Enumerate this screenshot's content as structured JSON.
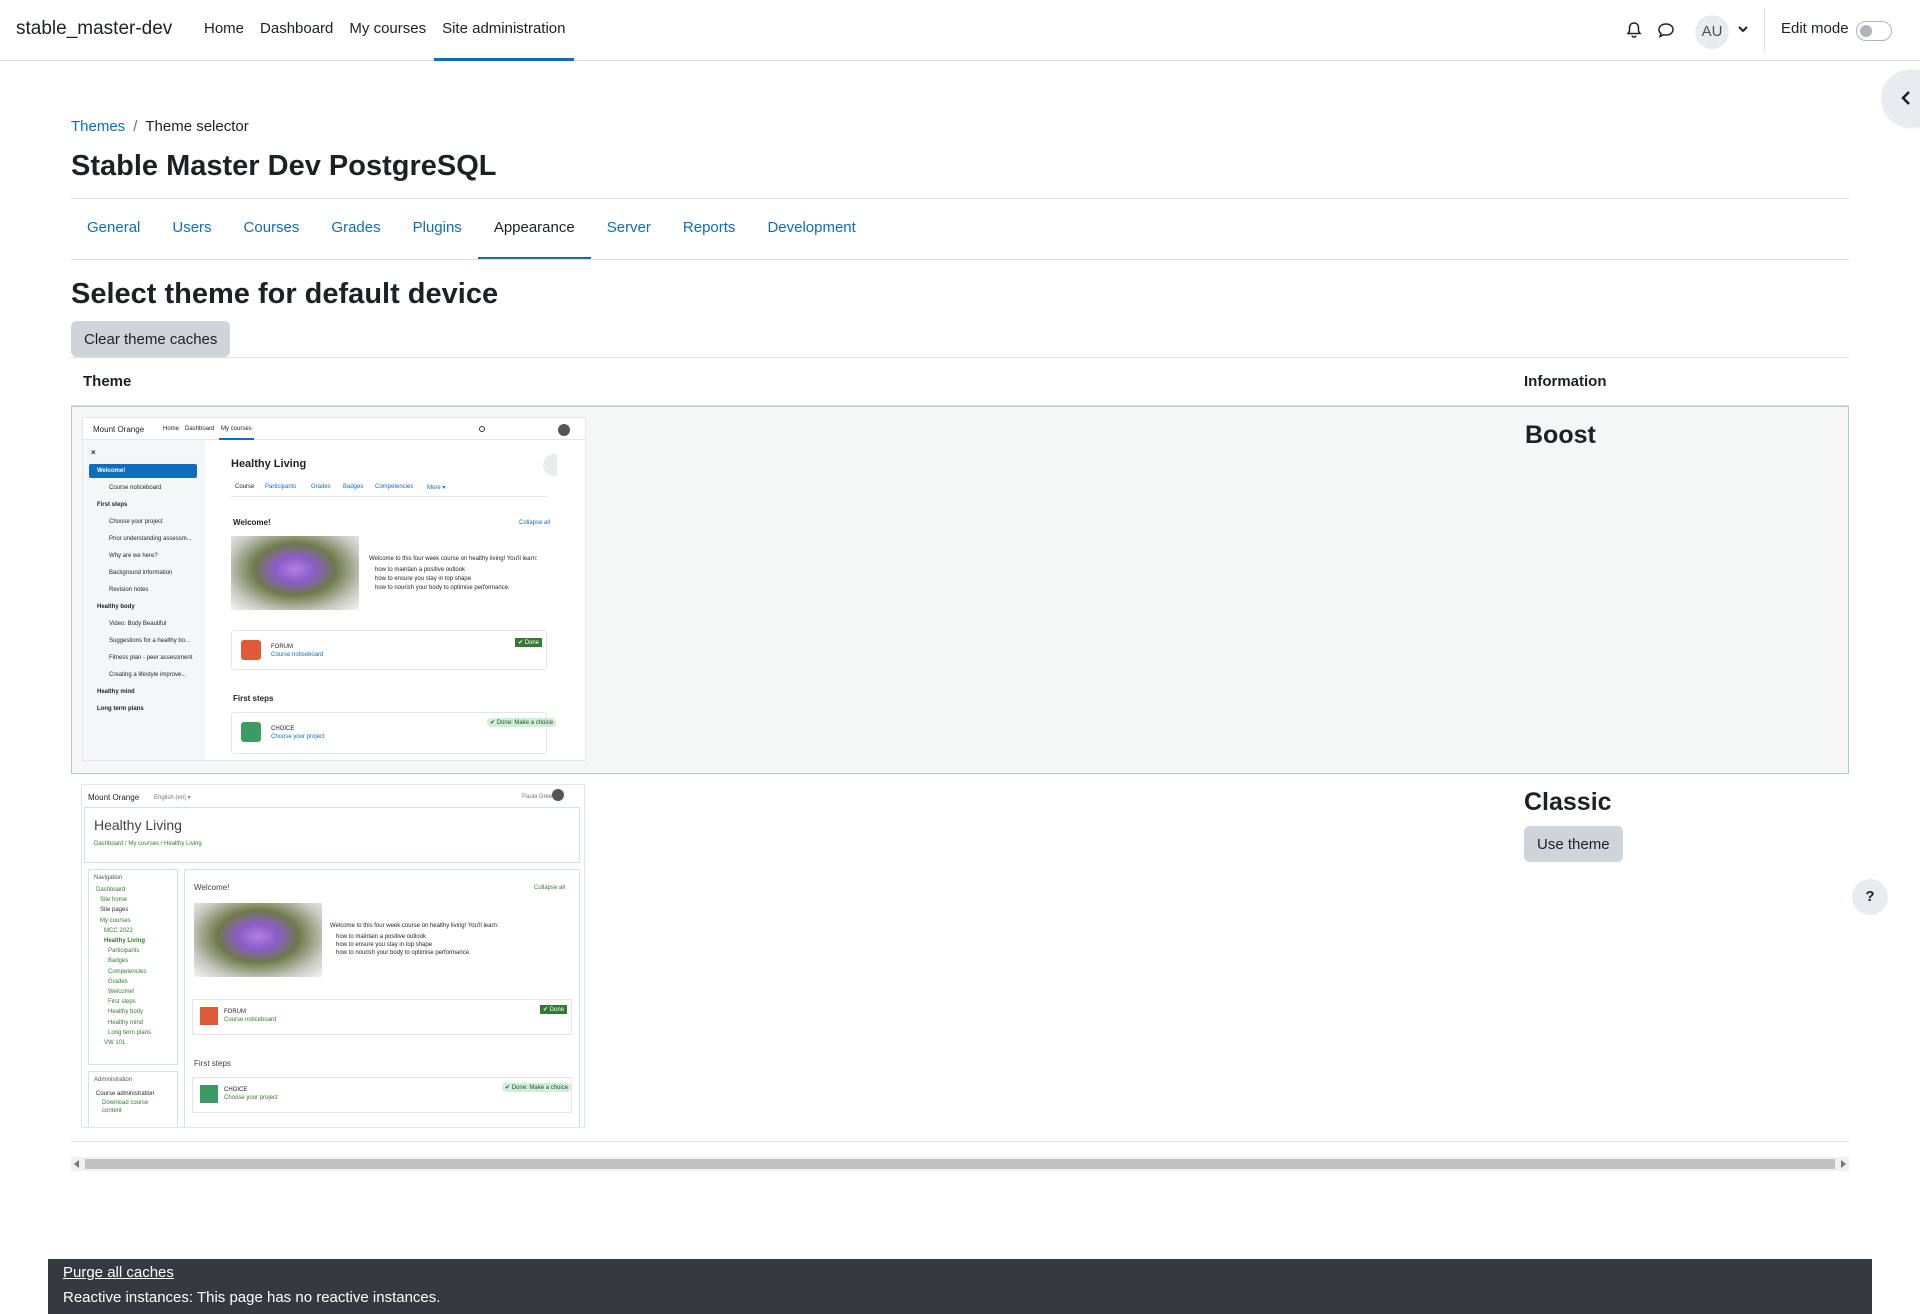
{
  "navbar": {
    "brand": "stable_master-dev",
    "items": [
      {
        "label": "Home"
      },
      {
        "label": "Dashboard"
      },
      {
        "label": "My courses"
      },
      {
        "label": "Site administration"
      }
    ],
    "avatar_initials": "AU",
    "edit_mode_label": "Edit mode",
    "edit_mode_on": false
  },
  "breadcrumb": {
    "parent": "Themes",
    "current": "Theme selector"
  },
  "page_title": "Stable Master Dev PostgreSQL",
  "tabs": [
    "General",
    "Users",
    "Courses",
    "Grades",
    "Plugins",
    "Appearance",
    "Server",
    "Reports",
    "Development"
  ],
  "section_title": "Select theme for default device",
  "clear_caches_label": "Clear theme caches",
  "table": {
    "col_theme": "Theme",
    "col_info": "Information",
    "rows": [
      {
        "name": "Boost",
        "current": true
      },
      {
        "name": "Classic",
        "current": false,
        "button": "Use theme"
      }
    ]
  },
  "preview_boost": {
    "site": "Mount Orange",
    "nav": [
      "Home",
      "Dashboard",
      "My courses"
    ],
    "course": "Healthy Living",
    "tabs": [
      "Course",
      "Participants",
      "Grades",
      "Badges",
      "Competencies",
      "More ▾"
    ],
    "index": [
      "Welcome!",
      "Course noticeboard",
      "First steps",
      "Choose your project",
      "Prior understanding assessm...",
      "Why are we here?",
      "Background information",
      "Revision notes",
      "Healthy body",
      "Video: Body Beautiful",
      "Suggestions for a healthy bo...",
      "Fitness plan - peer assessment",
      "Creating a lifestyle improve...",
      "Healthy mind",
      "Long term plans"
    ],
    "section1": "Welcome!",
    "collapse": "Collapse all",
    "intro": "Welcome to this four week course on healthy living! You'll learn:",
    "bullets": [
      "how to maintain a positive outlook",
      "how to ensure you stay in top shape",
      "how to nourish your body to optimise performance."
    ],
    "forum_type": "FORUM",
    "forum_name": "Course noticeboard",
    "done": "✔ Done",
    "section2": "First steps",
    "choice_type": "CHOICE",
    "choice_name": "Choose your project",
    "choice_done": "✔ Done: Make a choice"
  },
  "preview_classic": {
    "site": "Mount Orange",
    "lang": "English (en) ▾",
    "user": "Paula Green",
    "course": "Healthy Living",
    "crumbs": "Dashboard / My courses / Healthy Living",
    "nav_title": "Navigation",
    "nav_items": [
      "Dashboard",
      "Site home",
      "Site pages",
      "My courses",
      "MCC 2022",
      "Healthy Living",
      "Participants",
      "Badges",
      "Competencies",
      "Grades",
      "Welcome!",
      "First steps",
      "Healthy body",
      "Healthy mind",
      "Long term plans",
      "VW 101"
    ],
    "admin_title": "Administration",
    "admin_items": [
      "Course administration",
      "Download course",
      "content"
    ]
  },
  "footer": {
    "purge_label": "Purge all caches",
    "reactive_text": "Reactive instances: This page has no reactive instances."
  },
  "colors": {
    "link": "#0f6cbf",
    "footer_bg": "#343a40",
    "button_bg": "#ced4da",
    "moodle_green": "#357a32"
  }
}
